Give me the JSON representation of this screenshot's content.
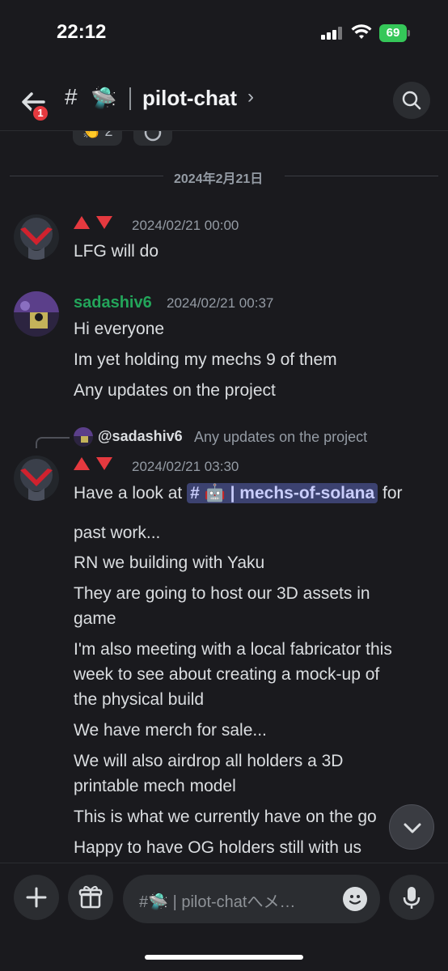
{
  "status": {
    "time": "22:12",
    "battery": "69"
  },
  "header": {
    "unread_badge": "1",
    "channel_hash": "#",
    "channel_emoji": "🛸",
    "channel_name": "pilot-chat",
    "chevron": "›"
  },
  "reactions": [
    {
      "emoji": "👏",
      "count": "2"
    }
  ],
  "date_separator": "2024年2月21日",
  "messages": [
    {
      "author": "🔺🔻",
      "timestamp": "2024/02/21 00:00",
      "lines": [
        "LFG will do"
      ]
    },
    {
      "author": "sadashiv6",
      "author_color": "#23a55a",
      "timestamp": "2024/02/21 00:37",
      "lines": [
        "Hi everyone",
        "Im yet holding my mechs 9 of them",
        "Any updates on the project"
      ]
    },
    {
      "reply": {
        "user": "@sadashiv6",
        "text": "Any updates on the project"
      },
      "author": "🔺🔻",
      "timestamp": "2024/02/21 03:30",
      "first_line_prefix": "Have a look at ",
      "mention": "# 🤖 | mechs-of-solana",
      "first_line_suffix": " for",
      "lines": [
        "past work...",
        "RN we building with Yaku",
        "They are going to host our 3D assets in",
        "game",
        "I'm also meeting with a local fabricator this",
        "week to see about creating a mock-up of",
        "the physical build",
        "We have merch for sale...",
        "We will also airdrop all holders a 3D",
        "printable mech model",
        "This is what we currently have on the go",
        "Happy to have OG holders still with us"
      ]
    }
  ],
  "composer": {
    "placeholder": "#🛸 | pilot-chatへメ…"
  },
  "colors": {
    "background": "#1a1a1e",
    "accent_mention": "#3c4270",
    "badge": "#e5393f",
    "online_green": "#23a55a"
  },
  "icons": [
    "back-arrow-icon",
    "search-icon",
    "plus-icon",
    "gift-icon",
    "emoji-icon",
    "microphone-icon",
    "chevron-down-icon"
  ]
}
